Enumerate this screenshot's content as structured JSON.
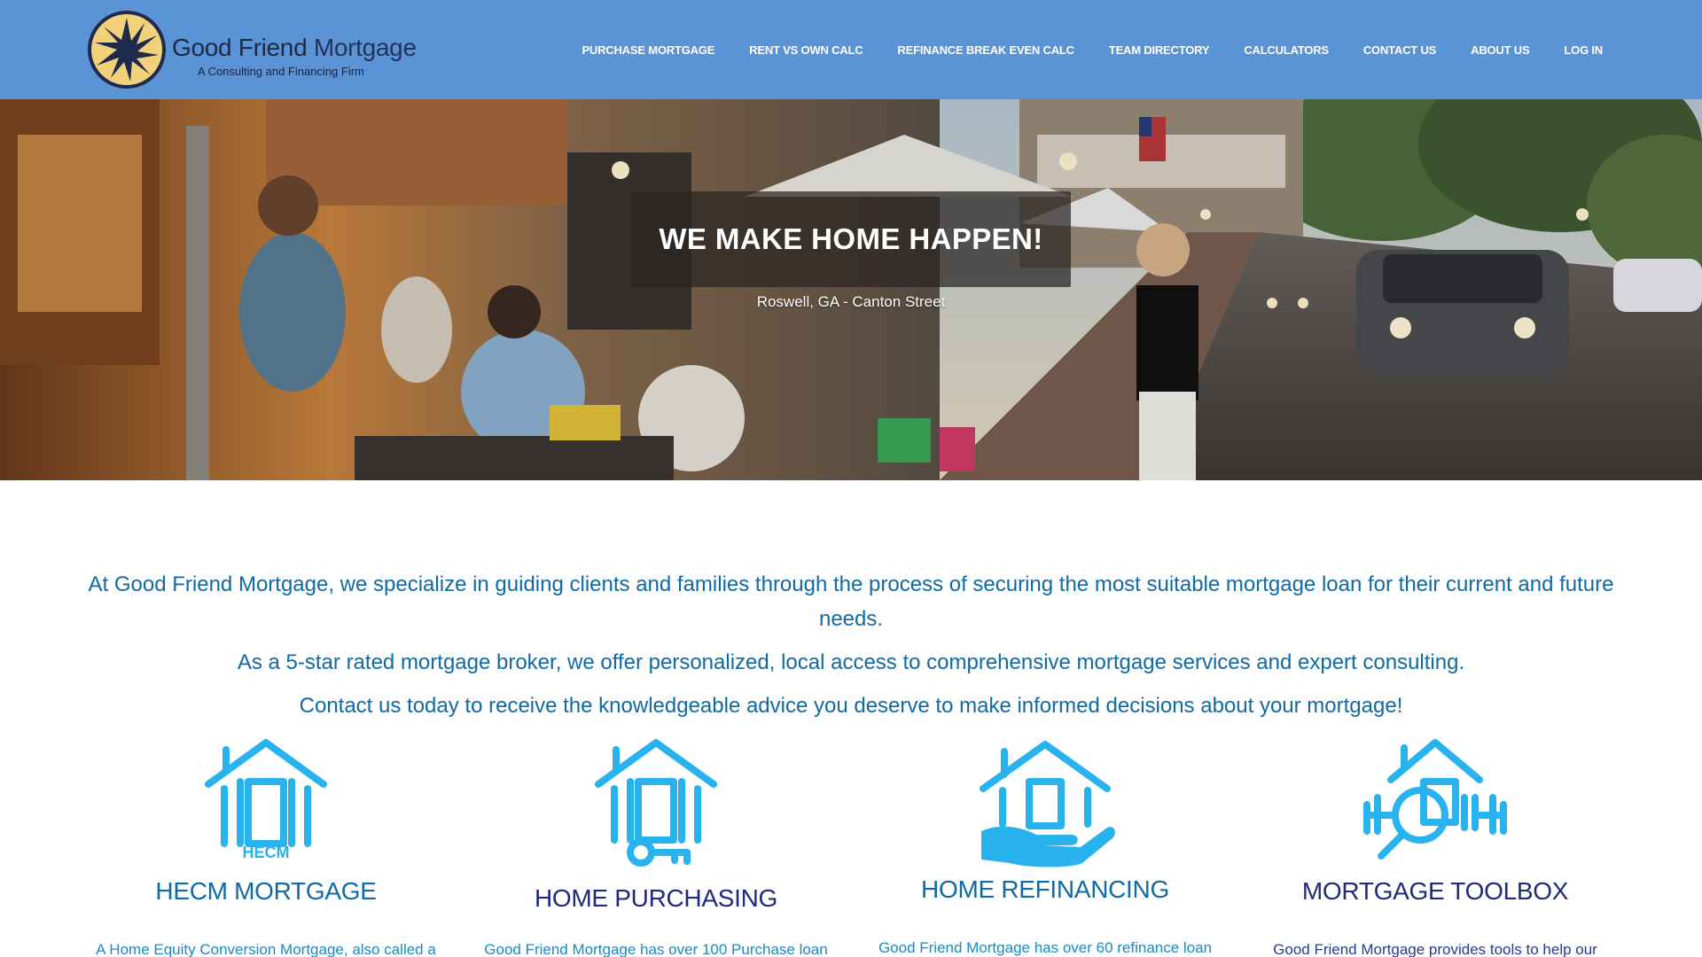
{
  "brand": {
    "name_part1": "Good Friend",
    "name_part2": "Mortgage",
    "tagline": "A Consulting and Financing Firm",
    "logo_icon": "starburst-logo-icon"
  },
  "nav": {
    "items": [
      {
        "label": "PURCHASE MORTGAGE"
      },
      {
        "label": "RENT VS OWN CALC"
      },
      {
        "label": "REFINANCE BREAK EVEN CALC"
      },
      {
        "label": "TEAM DIRECTORY"
      },
      {
        "label": "CALCULATORS"
      },
      {
        "label": "CONTACT US"
      },
      {
        "label": "ABOUT US"
      },
      {
        "label": "LOG IN"
      }
    ]
  },
  "hero": {
    "title": "WE MAKE HOME HAPPEN!",
    "caption": "Roswell, GA - Canton Street"
  },
  "intro": {
    "p1": "At Good Friend Mortgage, we specialize in guiding clients and families through the process of securing the most suitable mortgage loan for their current and future needs.",
    "p2": "As a 5-star rated mortgage broker, we offer personalized, local access to comprehensive mortgage services and expert consulting.",
    "p3": "Contact us today to receive the knowledgeable advice you deserve to make informed decisions about your mortgage!"
  },
  "services": [
    {
      "icon": "house-hecm-icon",
      "icon_text": "HECM",
      "title": "HECM MORTGAGE",
      "text": "A Home Equity Conversion Mortgage, also called a"
    },
    {
      "icon": "house-key-icon",
      "title": "HOME PURCHASING",
      "text": "Good Friend Mortgage has over 100 Purchase loan"
    },
    {
      "icon": "house-hand-icon",
      "title": "HOME REFINANCING",
      "text": "Good Friend Mortgage has over 60 refinance loan"
    },
    {
      "icon": "house-magnifier-icon",
      "title": "MORTGAGE TOOLBOX",
      "text": "Good Friend Mortgage provides tools to help our"
    }
  ],
  "colors": {
    "header_bg": "#5a93d6",
    "intro_text": "#0f6aa5",
    "icon_blue": "#29b3ee",
    "title_navy": "#1f2a7a"
  }
}
